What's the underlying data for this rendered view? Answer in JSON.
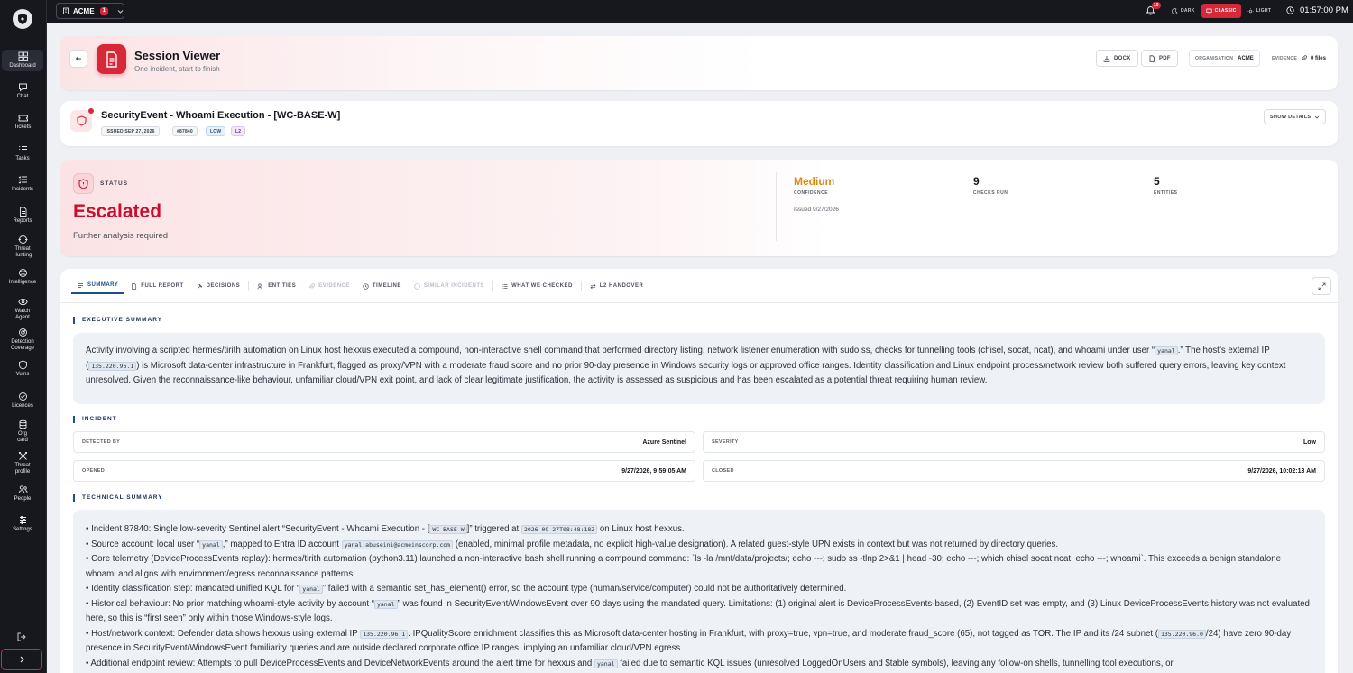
{
  "topbar": {
    "org_name": "ACME",
    "org_badge": "1",
    "notification_count": "10",
    "theme_options": [
      "DARK",
      "CLASSIC",
      "LIGHT"
    ],
    "theme_selected": "CLASSIC",
    "time": "01:57:00 PM"
  },
  "sidebar": {
    "items": [
      {
        "label": "Dashboard",
        "icon": "grid-icon"
      },
      {
        "label": "Chat",
        "icon": "chat-icon"
      },
      {
        "label": "Tickets",
        "icon": "ticket-icon"
      },
      {
        "label": "Tasks",
        "icon": "tasks-icon"
      },
      {
        "label": "Incidents",
        "icon": "incidents-icon"
      },
      {
        "label": "Reports",
        "icon": "report-icon"
      },
      {
        "label": "Threat\nHunting",
        "icon": "crosshair-icon"
      },
      {
        "label": "Intelligence",
        "icon": "intelligence-icon"
      },
      {
        "label": "Watch\nAgent",
        "icon": "eye-icon"
      },
      {
        "label": "Detection\nCoverage",
        "icon": "radar-icon"
      },
      {
        "label": "Vulns",
        "icon": "shield-icon"
      },
      {
        "label": "Licences",
        "icon": "check-circle-icon"
      },
      {
        "label": "Org\ncard",
        "icon": "database-icon"
      },
      {
        "label": "Threat\nprofile",
        "icon": "threat-profile-icon"
      },
      {
        "label": "People",
        "icon": "people-icon"
      },
      {
        "label": "Settings",
        "icon": "settings-icon"
      }
    ]
  },
  "header": {
    "title": "Session Viewer",
    "subtitle": "One incident, start to finish",
    "docx_label": "DOCX",
    "pdf_label": "PDF",
    "organisation_label": "ORGANISATION",
    "organisation_value": "ACME",
    "evidence_label": "EVIDENCE",
    "evidence_value": "0 files"
  },
  "incident": {
    "title": "SecurityEvent - Whoami Execution - [WC-BASE-W]",
    "issued": "ISSUED SEP 27, 2026",
    "id": "#87840",
    "severity": "LOW",
    "tier": "L2",
    "show_details": "SHOW DETAILS"
  },
  "status": {
    "label": "STATUS",
    "value": "Escalated",
    "description": "Further analysis required",
    "confidence_value": "Medium",
    "confidence_label": "CONFIDENCE",
    "checks_value": "9",
    "checks_label": "CHECKS RUN",
    "entities_value": "5",
    "entities_label": "ENTITIES",
    "issued": "Issued 9/27/2026",
    "confidence_color": "#d98a0f",
    "status_color": "#c8102e"
  },
  "tabs": [
    {
      "label": "SUMMARY",
      "state": "active"
    },
    {
      "label": "FULL REPORT",
      "state": "normal"
    },
    {
      "label": "DECISIONS",
      "state": "normal"
    },
    {
      "label": "ENTITIES",
      "state": "normal"
    },
    {
      "label": "EVIDENCE",
      "state": "disabled"
    },
    {
      "label": "TIMELINE",
      "state": "normal"
    },
    {
      "label": "SIMILAR INCIDENTS",
      "state": "disabled"
    },
    {
      "label": "WHAT WE CHECKED",
      "state": "normal"
    },
    {
      "label": "L2 HANDOVER",
      "state": "normal"
    }
  ],
  "summary": {
    "exec_heading": "EXECUTIVE SUMMARY",
    "exec_parts": {
      "p1": "Activity involving a scripted hermes/tirith automation on Linux host hexxus executed a compound, non-interactive shell command that performed directory listing, network listener enumeration with sudo ss, checks for tunnelling tools (chisel, socat, ncat), and whoami under user “",
      "c1": "yanal",
      "p2": ".” The host’s external IP (",
      "c2": "135.220.96.1",
      "p3": ") is Microsoft data-center infrastructure in Frankfurt, flagged as proxy/VPN with a moderate fraud score and no prior 90-day presence in Windows security logs or approved office ranges. Identity classification and Linux endpoint process/network review both suffered query errors, leaving key context unresolved. Given the reconnaissance-like behaviour, unfamiliar cloud/VPN exit point, and lack of clear legitimate justification, the activity is assessed as suspicious and has been escalated as a potential threat requiring human review."
    },
    "incident_heading": "INCIDENT",
    "fields": {
      "detected_by_label": "DETECTED BY",
      "detected_by_value": "Azure Sentinel",
      "severity_label": "SEVERITY",
      "severity_value": "Low",
      "opened_label": "OPENED",
      "opened_value": "9/27/2026, 9:59:05 AM",
      "closed_label": "CLOSED",
      "closed_value": "9/27/2026, 10:02:13 AM"
    },
    "tech_heading": "TECHNICAL SUMMARY",
    "tech": {
      "b1a": "• Incident 87840: Single low-severity Sentinel alert “SecurityEvent - Whoami Execution - [",
      "b1c1": "WC-BASE-W",
      "b1b": "]” triggered at ",
      "b1c2": "2026-09-27T08:48:18Z",
      "b1c": " on Linux host hexxus.",
      "b2a": "• Source account: local user “",
      "b2c1": "yanal",
      "b2b": ",” mapped to Entra ID account ",
      "b2c2": "yanal.abuseini@acmeinscorp.com",
      "b2c": " (enabled, minimal profile metadata, no explicit high-value designation). A related guest-style UPN exists in context but was not returned by directory queries.",
      "b3": "• Core telemetry (DeviceProcessEvents replay): hermes/tirith automation (python3.11) launched a non-interactive bash shell running a compound command: `ls -la /mnt/data/projects/; echo ---; sudo ss -tlnp 2>&1 | head -30; echo ---; which chisel socat ncat; echo ---; whoami`. This exceeds a benign standalone whoami and aligns with environment/egress reconnaissance patterns.",
      "b4a": "• Identity classification step: mandated unified KQL for “",
      "b4c1": "yanal",
      "b4b": "” failed with a semantic set_has_element() error, so the account type (human/service/computer) could not be authoritatively determined.",
      "b5a": "• Historical behaviour: No prior matching whoami-style activity by account “",
      "b5c1": "yanal",
      "b5b": "” was found in SecurityEvent/WindowsEvent over 90 days using the mandated query. Limitations: (1) original alert is DeviceProcessEvents-based, (2) EventID set was empty, and (3) Linux DeviceProcessEvents history was not evaluated here, so this is “first seen” only within those Windows-style logs.",
      "b6a": "• Host/network context: Defender data shows hexxus using external IP ",
      "b6c1": "135.220.96.1",
      "b6b": ". IPQualityScore enrichment classifies this as Microsoft data-center hosting in Frankfurt, with proxy=true, vpn=true, and moderate fraud_score (65), not tagged as TOR. The IP and its /24 subnet (",
      "b6c2": "135.220.96.0",
      "b6c": "/24) have zero 90-day presence in SecurityEvent/WindowsEvent familiarity queries and are outside declared corporate office IP ranges, implying an unfamiliar cloud/VPN egress.",
      "b7a": "• Additional endpoint review: Attempts to pull DeviceProcessEvents and DeviceNetworkEvents around the alert time for hexxus and ",
      "b7c1": "yanal",
      "b7b": " failed due to semantic KQL issues (unresolved LoggedOnUsers and $table symbols), leaving any follow-on shells, tunnelling tool executions, or"
    }
  }
}
